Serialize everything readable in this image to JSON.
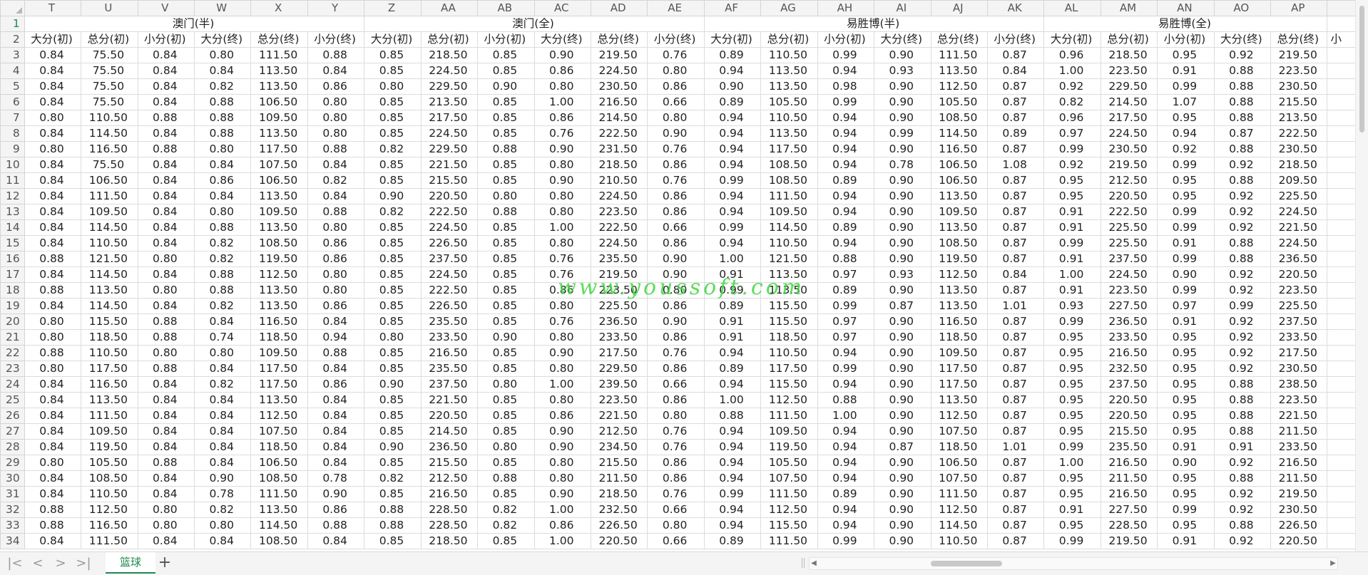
{
  "spreadsheet": {
    "columns": [
      "T",
      "U",
      "V",
      "W",
      "X",
      "Y",
      "Z",
      "AA",
      "AB",
      "AC",
      "AD",
      "AE",
      "AF",
      "AG",
      "AH",
      "AI",
      "AJ",
      "AK",
      "AL",
      "AM",
      "AN",
      "AO",
      "AP"
    ],
    "group_headers": [
      {
        "label": "澳门(半)",
        "span": 6
      },
      {
        "label": "澳门(全)",
        "span": 6
      },
      {
        "label": "易胜博(半)",
        "span": 6
      },
      {
        "label": "易胜博(全)",
        "span": 5
      }
    ],
    "subheaders": [
      "大分(初)",
      "总分(初)",
      "小分(初)",
      "大分(终)",
      "总分(终)",
      "小分(终)",
      "大分(初)",
      "总分(初)",
      "小分(初)",
      "大分(终)",
      "总分(终)",
      "小分(终)",
      "大分(初)",
      "总分(初)",
      "小分(初)",
      "大分(终)",
      "总分(终)",
      "小分(终)",
      "大分(初)",
      "总分(初)",
      "小分(初)",
      "大分(终)",
      "总分(终)"
    ],
    "overflow_text": "小",
    "rows": [
      {
        "n": "3",
        "c": [
          "0.84",
          "75.50",
          "0.84",
          "0.80",
          "111.50",
          "0.88",
          "0.85",
          "218.50",
          "0.85",
          "0.90",
          "219.50",
          "0.76",
          "0.89",
          "110.50",
          "0.99",
          "0.90",
          "111.50",
          "0.87",
          "0.96",
          "218.50",
          "0.95",
          "0.92",
          "219.50"
        ]
      },
      {
        "n": "4",
        "c": [
          "0.84",
          "75.50",
          "0.84",
          "0.84",
          "113.50",
          "0.84",
          "0.85",
          "224.50",
          "0.85",
          "0.86",
          "224.50",
          "0.80",
          "0.94",
          "113.50",
          "0.94",
          "0.93",
          "113.50",
          "0.84",
          "1.00",
          "223.50",
          "0.91",
          "0.88",
          "223.50"
        ]
      },
      {
        "n": "5",
        "c": [
          "0.84",
          "75.50",
          "0.84",
          "0.82",
          "113.50",
          "0.86",
          "0.80",
          "229.50",
          "0.90",
          "0.80",
          "230.50",
          "0.86",
          "0.90",
          "113.50",
          "0.98",
          "0.90",
          "112.50",
          "0.87",
          "0.92",
          "229.50",
          "0.99",
          "0.88",
          "230.50"
        ]
      },
      {
        "n": "6",
        "c": [
          "0.84",
          "75.50",
          "0.84",
          "0.88",
          "106.50",
          "0.80",
          "0.85",
          "213.50",
          "0.85",
          "1.00",
          "216.50",
          "0.66",
          "0.89",
          "105.50",
          "0.99",
          "0.90",
          "105.50",
          "0.87",
          "0.82",
          "214.50",
          "1.07",
          "0.88",
          "215.50"
        ]
      },
      {
        "n": "7",
        "c": [
          "0.80",
          "110.50",
          "0.88",
          "0.88",
          "109.50",
          "0.80",
          "0.85",
          "217.50",
          "0.85",
          "0.86",
          "214.50",
          "0.80",
          "0.94",
          "110.50",
          "0.94",
          "0.90",
          "108.50",
          "0.87",
          "0.96",
          "217.50",
          "0.95",
          "0.88",
          "213.50"
        ]
      },
      {
        "n": "8",
        "c": [
          "0.84",
          "114.50",
          "0.84",
          "0.88",
          "113.50",
          "0.80",
          "0.85",
          "224.50",
          "0.85",
          "0.76",
          "222.50",
          "0.90",
          "0.94",
          "113.50",
          "0.94",
          "0.99",
          "114.50",
          "0.89",
          "0.97",
          "224.50",
          "0.94",
          "0.87",
          "222.50"
        ]
      },
      {
        "n": "9",
        "c": [
          "0.80",
          "116.50",
          "0.88",
          "0.80",
          "117.50",
          "0.88",
          "0.82",
          "229.50",
          "0.88",
          "0.90",
          "231.50",
          "0.76",
          "0.94",
          "117.50",
          "0.94",
          "0.90",
          "116.50",
          "0.87",
          "0.99",
          "230.50",
          "0.92",
          "0.88",
          "230.50"
        ]
      },
      {
        "n": "10",
        "c": [
          "0.84",
          "75.50",
          "0.84",
          "0.84",
          "107.50",
          "0.84",
          "0.85",
          "221.50",
          "0.85",
          "0.80",
          "218.50",
          "0.86",
          "0.94",
          "108.50",
          "0.94",
          "0.78",
          "106.50",
          "1.08",
          "0.92",
          "219.50",
          "0.99",
          "0.92",
          "218.50"
        ]
      },
      {
        "n": "11",
        "c": [
          "0.84",
          "106.50",
          "0.84",
          "0.86",
          "106.50",
          "0.82",
          "0.85",
          "215.50",
          "0.85",
          "0.90",
          "210.50",
          "0.76",
          "0.99",
          "108.50",
          "0.89",
          "0.90",
          "106.50",
          "0.87",
          "0.95",
          "212.50",
          "0.95",
          "0.88",
          "209.50"
        ]
      },
      {
        "n": "12",
        "c": [
          "0.84",
          "111.50",
          "0.84",
          "0.84",
          "113.50",
          "0.84",
          "0.90",
          "220.50",
          "0.80",
          "0.80",
          "224.50",
          "0.86",
          "0.94",
          "111.50",
          "0.94",
          "0.90",
          "113.50",
          "0.87",
          "0.95",
          "220.50",
          "0.95",
          "0.92",
          "225.50"
        ]
      },
      {
        "n": "13",
        "c": [
          "0.84",
          "109.50",
          "0.84",
          "0.80",
          "109.50",
          "0.88",
          "0.82",
          "222.50",
          "0.88",
          "0.80",
          "223.50",
          "0.86",
          "0.94",
          "109.50",
          "0.94",
          "0.90",
          "109.50",
          "0.87",
          "0.91",
          "222.50",
          "0.99",
          "0.92",
          "224.50"
        ]
      },
      {
        "n": "14",
        "c": [
          "0.84",
          "114.50",
          "0.84",
          "0.88",
          "113.50",
          "0.80",
          "0.85",
          "224.50",
          "0.85",
          "1.00",
          "222.50",
          "0.66",
          "0.99",
          "114.50",
          "0.89",
          "0.90",
          "113.50",
          "0.87",
          "0.91",
          "225.50",
          "0.99",
          "0.92",
          "221.50"
        ]
      },
      {
        "n": "15",
        "c": [
          "0.84",
          "110.50",
          "0.84",
          "0.82",
          "108.50",
          "0.86",
          "0.85",
          "226.50",
          "0.85",
          "0.80",
          "224.50",
          "0.86",
          "0.94",
          "110.50",
          "0.94",
          "0.90",
          "108.50",
          "0.87",
          "0.99",
          "225.50",
          "0.91",
          "0.88",
          "224.50"
        ]
      },
      {
        "n": "16",
        "c": [
          "0.88",
          "121.50",
          "0.80",
          "0.82",
          "119.50",
          "0.86",
          "0.85",
          "237.50",
          "0.85",
          "0.76",
          "235.50",
          "0.90",
          "1.00",
          "121.50",
          "0.88",
          "0.90",
          "119.50",
          "0.87",
          "0.91",
          "237.50",
          "0.99",
          "0.88",
          "236.50"
        ]
      },
      {
        "n": "17",
        "c": [
          "0.84",
          "114.50",
          "0.84",
          "0.88",
          "112.50",
          "0.80",
          "0.85",
          "224.50",
          "0.85",
          "0.76",
          "219.50",
          "0.90",
          "0.91",
          "113.50",
          "0.97",
          "0.93",
          "112.50",
          "0.84",
          "1.00",
          "224.50",
          "0.90",
          "0.92",
          "220.50"
        ]
      },
      {
        "n": "18",
        "c": [
          "0.88",
          "113.50",
          "0.80",
          "0.88",
          "113.50",
          "0.80",
          "0.85",
          "222.50",
          "0.85",
          "0.86",
          "223.50",
          "0.80",
          "0.99",
          "113.50",
          "0.89",
          "0.90",
          "113.50",
          "0.87",
          "0.91",
          "223.50",
          "0.99",
          "0.92",
          "223.50"
        ]
      },
      {
        "n": "19",
        "c": [
          "0.84",
          "114.50",
          "0.84",
          "0.82",
          "113.50",
          "0.86",
          "0.85",
          "226.50",
          "0.85",
          "0.80",
          "225.50",
          "0.86",
          "0.89",
          "115.50",
          "0.99",
          "0.87",
          "113.50",
          "1.01",
          "0.93",
          "227.50",
          "0.97",
          "0.99",
          "225.50"
        ]
      },
      {
        "n": "20",
        "c": [
          "0.80",
          "115.50",
          "0.88",
          "0.84",
          "116.50",
          "0.84",
          "0.85",
          "235.50",
          "0.85",
          "0.76",
          "236.50",
          "0.90",
          "0.91",
          "115.50",
          "0.97",
          "0.90",
          "116.50",
          "0.87",
          "0.99",
          "236.50",
          "0.91",
          "0.92",
          "237.50"
        ]
      },
      {
        "n": "21",
        "c": [
          "0.80",
          "118.50",
          "0.88",
          "0.74",
          "118.50",
          "0.94",
          "0.80",
          "233.50",
          "0.90",
          "0.80",
          "233.50",
          "0.86",
          "0.91",
          "118.50",
          "0.97",
          "0.90",
          "118.50",
          "0.87",
          "0.95",
          "233.50",
          "0.95",
          "0.92",
          "233.50"
        ]
      },
      {
        "n": "22",
        "c": [
          "0.88",
          "110.50",
          "0.80",
          "0.80",
          "109.50",
          "0.88",
          "0.85",
          "216.50",
          "0.85",
          "0.90",
          "217.50",
          "0.76",
          "0.94",
          "110.50",
          "0.94",
          "0.90",
          "109.50",
          "0.87",
          "0.95",
          "216.50",
          "0.95",
          "0.92",
          "217.50"
        ]
      },
      {
        "n": "23",
        "c": [
          "0.80",
          "117.50",
          "0.88",
          "0.84",
          "117.50",
          "0.84",
          "0.85",
          "235.50",
          "0.85",
          "0.80",
          "229.50",
          "0.86",
          "0.89",
          "117.50",
          "0.99",
          "0.90",
          "117.50",
          "0.87",
          "0.95",
          "232.50",
          "0.95",
          "0.92",
          "230.50"
        ]
      },
      {
        "n": "24",
        "c": [
          "0.84",
          "116.50",
          "0.84",
          "0.82",
          "117.50",
          "0.86",
          "0.90",
          "237.50",
          "0.80",
          "1.00",
          "239.50",
          "0.66",
          "0.94",
          "115.50",
          "0.94",
          "0.90",
          "117.50",
          "0.87",
          "0.95",
          "237.50",
          "0.95",
          "0.88",
          "238.50"
        ]
      },
      {
        "n": "25",
        "c": [
          "0.84",
          "113.50",
          "0.84",
          "0.84",
          "113.50",
          "0.84",
          "0.85",
          "221.50",
          "0.85",
          "0.80",
          "223.50",
          "0.86",
          "1.00",
          "112.50",
          "0.88",
          "0.90",
          "113.50",
          "0.87",
          "0.95",
          "220.50",
          "0.95",
          "0.88",
          "223.50"
        ]
      },
      {
        "n": "26",
        "c": [
          "0.84",
          "111.50",
          "0.84",
          "0.84",
          "112.50",
          "0.84",
          "0.85",
          "220.50",
          "0.85",
          "0.86",
          "221.50",
          "0.80",
          "0.88",
          "111.50",
          "1.00",
          "0.90",
          "112.50",
          "0.87",
          "0.95",
          "220.50",
          "0.95",
          "0.88",
          "221.50"
        ]
      },
      {
        "n": "27",
        "c": [
          "0.84",
          "109.50",
          "0.84",
          "0.84",
          "107.50",
          "0.84",
          "0.85",
          "214.50",
          "0.85",
          "0.90",
          "212.50",
          "0.76",
          "0.94",
          "109.50",
          "0.94",
          "0.90",
          "107.50",
          "0.87",
          "0.95",
          "215.50",
          "0.95",
          "0.88",
          "211.50"
        ]
      },
      {
        "n": "28",
        "c": [
          "0.84",
          "119.50",
          "0.84",
          "0.84",
          "118.50",
          "0.84",
          "0.90",
          "236.50",
          "0.80",
          "0.90",
          "234.50",
          "0.76",
          "0.94",
          "119.50",
          "0.94",
          "0.87",
          "118.50",
          "1.01",
          "0.99",
          "235.50",
          "0.91",
          "0.91",
          "233.50"
        ]
      },
      {
        "n": "29",
        "c": [
          "0.80",
          "105.50",
          "0.88",
          "0.84",
          "106.50",
          "0.84",
          "0.85",
          "215.50",
          "0.85",
          "0.80",
          "215.50",
          "0.86",
          "0.94",
          "105.50",
          "0.94",
          "0.90",
          "106.50",
          "0.87",
          "1.00",
          "216.50",
          "0.90",
          "0.92",
          "216.50"
        ]
      },
      {
        "n": "30",
        "c": [
          "0.84",
          "108.50",
          "0.84",
          "0.90",
          "108.50",
          "0.78",
          "0.82",
          "212.50",
          "0.88",
          "0.80",
          "211.50",
          "0.86",
          "0.94",
          "107.50",
          "0.94",
          "0.90",
          "107.50",
          "0.87",
          "0.95",
          "211.50",
          "0.95",
          "0.88",
          "211.50"
        ]
      },
      {
        "n": "31",
        "c": [
          "0.84",
          "110.50",
          "0.84",
          "0.78",
          "111.50",
          "0.90",
          "0.85",
          "216.50",
          "0.85",
          "0.90",
          "218.50",
          "0.76",
          "0.99",
          "111.50",
          "0.89",
          "0.90",
          "111.50",
          "0.87",
          "0.95",
          "216.50",
          "0.95",
          "0.92",
          "219.50"
        ]
      },
      {
        "n": "32",
        "c": [
          "0.88",
          "112.50",
          "0.80",
          "0.82",
          "113.50",
          "0.86",
          "0.88",
          "228.50",
          "0.82",
          "1.00",
          "232.50",
          "0.66",
          "0.94",
          "112.50",
          "0.94",
          "0.90",
          "112.50",
          "0.87",
          "0.91",
          "227.50",
          "0.99",
          "0.92",
          "230.50"
        ]
      },
      {
        "n": "33",
        "c": [
          "0.88",
          "116.50",
          "0.80",
          "0.80",
          "114.50",
          "0.88",
          "0.88",
          "228.50",
          "0.82",
          "0.86",
          "226.50",
          "0.80",
          "0.94",
          "115.50",
          "0.94",
          "0.90",
          "114.50",
          "0.87",
          "0.95",
          "228.50",
          "0.95",
          "0.88",
          "226.50"
        ]
      },
      {
        "n": "34",
        "c": [
          "0.84",
          "111.50",
          "0.84",
          "0.84",
          "108.50",
          "0.84",
          "0.85",
          "218.50",
          "0.85",
          "1.00",
          "220.50",
          "0.66",
          "0.89",
          "111.50",
          "0.99",
          "0.90",
          "110.50",
          "0.87",
          "0.99",
          "219.50",
          "0.91",
          "0.92",
          "220.50"
        ]
      }
    ]
  },
  "sheet_tabs": {
    "active": "篮球",
    "add_label": "+"
  },
  "nav": {
    "first": "|<",
    "prev": "<",
    "next": ">",
    "last": ">|"
  },
  "watermark": "www.youssoft.com",
  "colors": {
    "accent": "#1e8a4e",
    "watermark": "#43d643",
    "header_bg": "#f4f4f4",
    "grid": "#dcdcdc"
  }
}
